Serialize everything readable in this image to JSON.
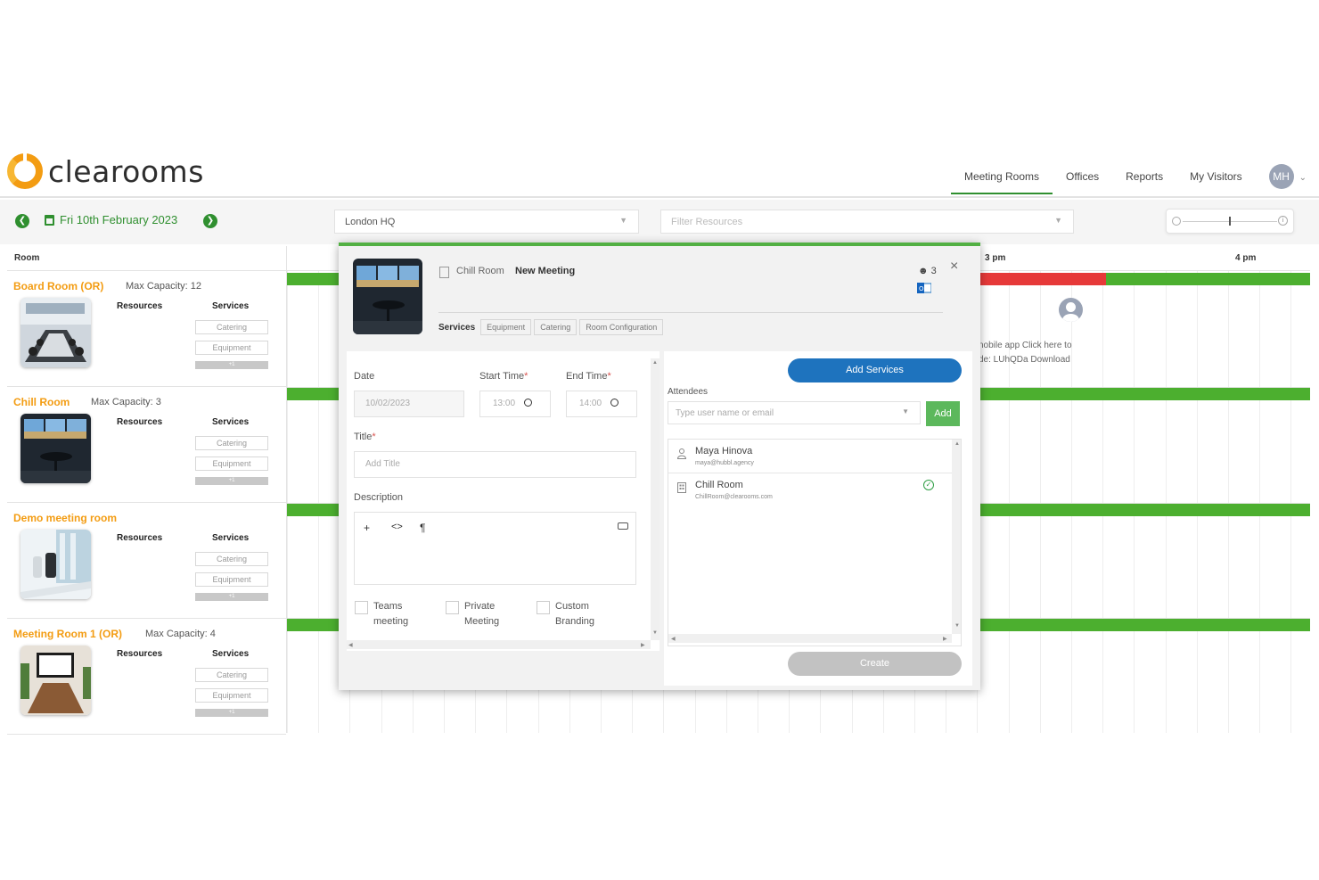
{
  "app": {
    "logo_text": "clearooms",
    "nav": [
      "Meeting Rooms",
      "Offices",
      "Reports",
      "My Visitors"
    ],
    "avatar_initials": "MH"
  },
  "toolbar": {
    "date_label": "Fri 10th February 2023",
    "location_select": "London HQ",
    "filter_placeholder": "Filter Resources"
  },
  "rooms": {
    "header": "Room",
    "resources_label": "Resources",
    "services_label": "Services",
    "service_buttons": [
      "Catering",
      "Equipment"
    ],
    "more_label": "+1",
    "items": [
      {
        "name": "Board Room (OR)",
        "capacity": "Max Capacity: 12"
      },
      {
        "name": "Chill Room",
        "capacity": "Max Capacity: 3"
      },
      {
        "name": "Demo meeting room",
        "capacity": ""
      },
      {
        "name": "Meeting Room 1 (OR)",
        "capacity": "Max Capacity: 4"
      }
    ]
  },
  "timeline": {
    "hours": [
      "3 pm",
      "4 pm"
    ],
    "note_line1": "nobile app Click here to",
    "note_line2": "de: LUhQDa Download",
    "colors": {
      "available": "#4caf2f",
      "booked": "#e63939"
    }
  },
  "modal": {
    "room": "Chill Room",
    "title": "New Meeting",
    "attendee_count": "3",
    "tabs_label": "Services",
    "tabs": [
      "Equipment",
      "Catering",
      "Room Configuration"
    ],
    "form": {
      "date_label": "Date",
      "date_value": "10/02/2023",
      "start_label": "Start Time",
      "start_value": "13:00",
      "end_label": "End Time",
      "end_value": "14:00",
      "title_label": "Title",
      "title_placeholder": "Add Title",
      "description_label": "Description",
      "editor_buttons": [
        "+",
        "<>",
        "¶"
      ],
      "checkboxes": [
        {
          "line1": "Teams",
          "line2": "meeting"
        },
        {
          "line1": "Private",
          "line2": "Meeting"
        },
        {
          "line1": "Custom",
          "line2": "Branding"
        }
      ],
      "required_mark": "*"
    },
    "add_services_label": "Add Services",
    "attendees_label": "Attendees",
    "attendee_placeholder": "Type user name or email",
    "add_button": "Add",
    "attendees": [
      {
        "name": "Maya Hinova",
        "email": "maya@hubbl.agency"
      },
      {
        "name": "Chill Room",
        "email": "ChillRoom@clearooms.com"
      }
    ],
    "create_label": "Create",
    "close_glyph": "×"
  }
}
